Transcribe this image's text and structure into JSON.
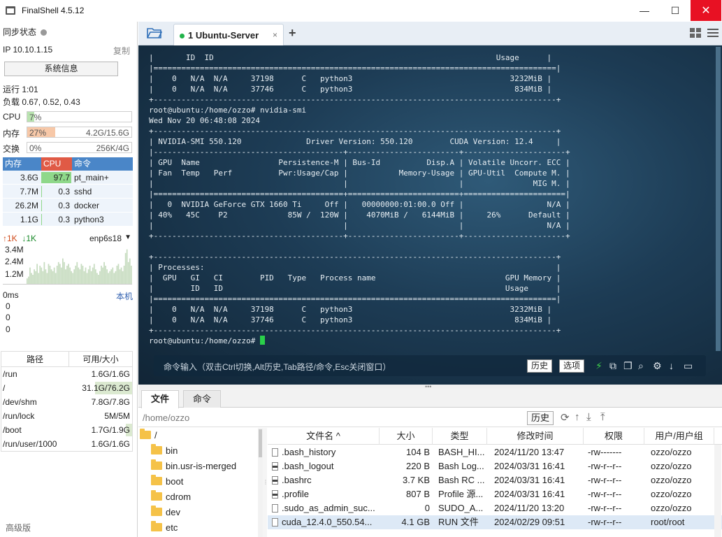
{
  "window": {
    "title": "FinalShell 4.5.12",
    "min_glyph": "—",
    "max_glyph": "☐",
    "close_glyph": "✕"
  },
  "left_panel": {
    "sync_status": "同步状态",
    "ip": "IP  10.10.1.15",
    "copy": "复制",
    "sysinfo_button": "系统信息",
    "uptime": "运行 1:01",
    "load": "负载 0.67, 0.52, 0.43",
    "cpu": {
      "label": "CPU",
      "percent": 7,
      "text": "7%"
    },
    "mem": {
      "label": "内存",
      "percent": 27,
      "text": "27%",
      "detail": "4.2G/15.6G"
    },
    "swap": {
      "label": "交换",
      "percent": 0,
      "text": "0%",
      "detail": "256K/4G"
    },
    "process_table": {
      "headers": [
        "内存",
        "CPU",
        "命令"
      ],
      "rows": [
        {
          "mem": "3.6G",
          "cpu": "97.7",
          "cpu_pct": 97.7,
          "cmd": "pt_main+"
        },
        {
          "mem": "7.7M",
          "cpu": "0.3",
          "cpu_pct": 0.3,
          "cmd": "sshd"
        },
        {
          "mem": "26.2M",
          "cpu": "0.3",
          "cpu_pct": 0.3,
          "cmd": "docker"
        },
        {
          "mem": "1.1G",
          "cpu": "0.3",
          "cpu_pct": 0.3,
          "cmd": "python3"
        }
      ]
    },
    "network": {
      "up": "↑1K",
      "down": "↓1K",
      "iface": "enp6s18",
      "caret": "▼",
      "ticks": [
        "3.4M",
        "2.4M",
        "1.2M"
      ],
      "samples": [
        0.15,
        0.2,
        0.45,
        0.3,
        0.25,
        0.4,
        0.35,
        0.55,
        0.3,
        0.5,
        0.45,
        0.35,
        0.6,
        0.4,
        0.3,
        0.55,
        0.5,
        0.4,
        0.35,
        0.45,
        0.3,
        0.5,
        0.6,
        0.55,
        0.45,
        0.7,
        0.6,
        0.4,
        0.5,
        0.55,
        0.45,
        0.35,
        0.3,
        0.4,
        0.5,
        0.6,
        0.45,
        0.4,
        0.55,
        0.5,
        0.35,
        0.45,
        0.3,
        0.4,
        0.5,
        0.35,
        0.45,
        0.55,
        0.4,
        0.3,
        0.25,
        0.35,
        0.5,
        0.45,
        0.6,
        0.5,
        0.4,
        0.3,
        0.35,
        0.4,
        0.45,
        0.3,
        0.35,
        0.5,
        0.55,
        0.4,
        0.45,
        0.35,
        0.5,
        0.85,
        0.95,
        0.6,
        0.7,
        0.5
      ]
    },
    "ping": {
      "label": "0ms",
      "host": "本机",
      "values": [
        "0",
        "0",
        "0"
      ]
    },
    "disk_table": {
      "headers": [
        "路径",
        "可用/大小"
      ],
      "rows": [
        {
          "path": "/run",
          "avail": "1.6G/1.6G",
          "used_pct": 0
        },
        {
          "path": "/",
          "avail": "31.1G/76.2G",
          "used_pct": 59
        },
        {
          "path": "/dev/shm",
          "avail": "7.8G/7.8G",
          "used_pct": 0
        },
        {
          "path": "/run/lock",
          "avail": "5M/5M",
          "used_pct": 0
        },
        {
          "path": "/boot",
          "avail": "1.7G/1.9G",
          "used_pct": 10
        },
        {
          "path": "/run/user/1000",
          "avail": "1.6G/1.6G",
          "used_pct": 0
        }
      ]
    },
    "advanced": "高级版"
  },
  "tabs": {
    "session_label": "1 Ubuntu-Server",
    "close_glyph": "×",
    "add_glyph": "+"
  },
  "terminal": {
    "lines": [
      "|       ID  ID                                                             Usage      |",
      "|=======================================================================================|",
      "|    0   N/A  N/A     37198      C   python3                                  3232MiB |",
      "|    0   N/A  N/A     37746      C   python3                                   834MiB |",
      "+---------------------------------------------------------------------------------------+",
      "root@ubuntu:/home/ozzo# nvidia-smi",
      "Wed Nov 20 06:48:08 2024",
      "+---------------------------------------------------------------------------------------+",
      "| NVIDIA-SMI 550.120              Driver Version: 550.120        CUDA Version: 12.4     |",
      "|-----------------------------------------+------------------------+----------------------+",
      "| GPU  Name                 Persistence-M | Bus-Id          Disp.A | Volatile Uncorr. ECC |",
      "| Fan  Temp   Perf          Pwr:Usage/Cap |           Memory-Usage | GPU-Util  Compute M. |",
      "|                                         |                        |               MIG M. |",
      "|=========================================+========================+======================|",
      "|   0  NVIDIA GeForce GTX 1660 Ti     Off |   00000000:01:00.0 Off |                  N/A |",
      "| 40%   45C    P2             85W /  120W |    4070MiB /   6144MiB |     26%      Default |",
      "|                                         |                        |                  N/A |",
      "+-----------------------------------------+------------------------+----------------------+",
      "",
      "+---------------------------------------------------------------------------------------+",
      "| Processes:                                                                            |",
      "|  GPU   GI   CI        PID   Type   Process name                            GPU Memory |",
      "|        ID   ID                                                             Usage      |",
      "|=======================================================================================|",
      "|    0   N/A  N/A     37198      C   python3                                  3232MiB |",
      "|    0   N/A  N/A     37746      C   python3                                   834MiB |",
      "+---------------------------------------------------------------------------------------+"
    ],
    "prompt": "root@ubuntu:/home/ozzo# ",
    "cmd_hint": "命令输入（双击Ctrl切换,Alt历史,Tab路径/命令,Esc关闭窗口）",
    "history_button": "历史",
    "options_button": "选项"
  },
  "files": {
    "tab_files": "文件",
    "tab_commands": "命令",
    "path": "/home/ozzo",
    "history_button": "历史",
    "tree": [
      {
        "name": "/",
        "level": 0
      },
      {
        "name": "bin",
        "level": 1
      },
      {
        "name": "bin.usr-is-merged",
        "level": 1
      },
      {
        "name": "boot",
        "level": 1
      },
      {
        "name": "cdrom",
        "level": 1
      },
      {
        "name": "dev",
        "level": 1
      },
      {
        "name": "etc",
        "level": 1
      }
    ],
    "columns": [
      "文件名 ^",
      "大小",
      "类型",
      "修改时间",
      "权限",
      "用户/用户组"
    ],
    "rows": [
      {
        "name": ".bash_history",
        "size": "104 B",
        "type": "BASH_HI...",
        "mtime": "2024/11/20 13:47",
        "perm": "-rw-------",
        "owner": "ozzo/ozzo",
        "icon": "file"
      },
      {
        "name": ".bash_logout",
        "size": "220 B",
        "type": "Bash Log...",
        "mtime": "2024/03/31 16:41",
        "perm": "-rw-r--r--",
        "owner": "ozzo/ozzo",
        "icon": "dark"
      },
      {
        "name": ".bashrc",
        "size": "3.7 KB",
        "type": "Bash RC ...",
        "mtime": "2024/03/31 16:41",
        "perm": "-rw-r--r--",
        "owner": "ozzo/ozzo",
        "icon": "dark"
      },
      {
        "name": ".profile",
        "size": "807 B",
        "type": "Profile 源...",
        "mtime": "2024/03/31 16:41",
        "perm": "-rw-r--r--",
        "owner": "ozzo/ozzo",
        "icon": "dark"
      },
      {
        "name": ".sudo_as_admin_suc...",
        "size": "0",
        "type": "SUDO_A...",
        "mtime": "2024/11/20 13:20",
        "perm": "-rw-r--r--",
        "owner": "ozzo/ozzo",
        "icon": "file"
      },
      {
        "name": "cuda_12.4.0_550.54...",
        "size": "4.1 GB",
        "type": "RUN 文件",
        "mtime": "2024/02/29 09:51",
        "perm": "-rw-r--r--",
        "owner": "root/root",
        "icon": "file"
      }
    ]
  },
  "colors": {
    "cpu_fill": "#b9e3b0",
    "mem_fill": "#f7c8a8",
    "proc_cpu_fill": "#8fd88a",
    "accent": "#4a86c8"
  }
}
